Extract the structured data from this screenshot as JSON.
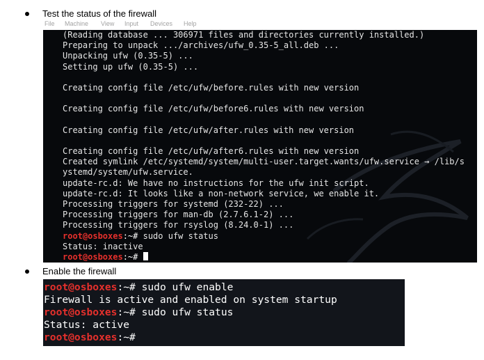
{
  "bullets": {
    "first": "Test the status of the firewall",
    "second": "Enable the firewall"
  },
  "vm_menu": [
    "File",
    "Machine",
    "View",
    "Input",
    "Devices",
    "Help"
  ],
  "terminal1": {
    "lines": [
      "(Reading database ... 306971 files and directories currently installed.)",
      "Preparing to unpack .../archives/ufw_0.35-5_all.deb ...",
      "Unpacking ufw (0.35-5) ...",
      "Setting up ufw (0.35-5) ...",
      "",
      "Creating config file /etc/ufw/before.rules with new version",
      "",
      "Creating config file /etc/ufw/before6.rules with new version",
      "",
      "Creating config file /etc/ufw/after.rules with new version",
      "",
      "Creating config file /etc/ufw/after6.rules with new version",
      "Created symlink /etc/systemd/system/multi-user.target.wants/ufw.service → /lib/s",
      "ystemd/system/ufw.service.",
      "update-rc.d: We have no instructions for the ufw init script.",
      "update-rc.d: It looks like a non-network service, we enable it.",
      "Processing triggers for systemd (232-22) ...",
      "Processing triggers for man-db (2.7.6.1-2) ...",
      "Processing triggers for rsyslog (8.24.0-1) ..."
    ],
    "prompt_user": "root@osboxes",
    "prompt_rest": ":~# ",
    "command": "sudo ufw status",
    "output": "Status: inactive"
  },
  "terminal2": {
    "prompt_user": "root@osboxes",
    "prompt_rest": ":~# ",
    "cmd1": "sudo ufw enable",
    "out1": "Firewall is active and enabled on system startup",
    "cmd2": "sudo ufw status",
    "out2": "Status: active"
  },
  "colors": {
    "prompt_user": "#e5302c",
    "terminal_text": "#e6e6e6",
    "terminal_bg": "#07090c"
  }
}
